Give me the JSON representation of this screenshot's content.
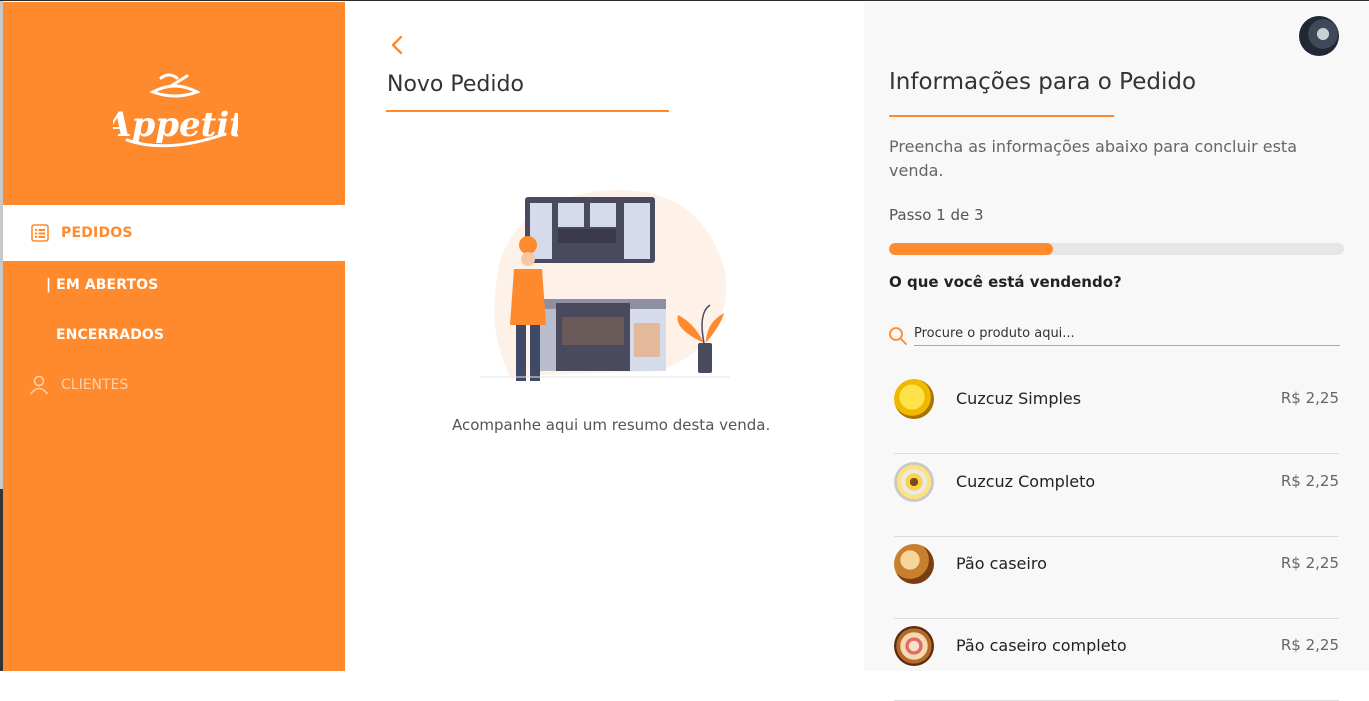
{
  "colors": {
    "accent": "#ff8a2e",
    "panel_bg": "#f8f8f8"
  },
  "sidebar": {
    "logo_text": "Appetit",
    "items": [
      {
        "label": "PEDIDOS",
        "icon": "list-icon",
        "active": true
      },
      {
        "label": "| EM ABERTOS"
      },
      {
        "label": "ENCERRADOS"
      },
      {
        "label": "CLIENTES",
        "icon": "user-icon"
      }
    ]
  },
  "main": {
    "title": "Novo Pedido",
    "caption": "Acompanhe aqui um resumo desta venda."
  },
  "panel": {
    "title": "Informações para o Pedido",
    "description": "Preencha as informações abaixo para concluir esta venda.",
    "step_text": "Passo 1 de 3",
    "progress_fraction": 0.36,
    "question": "O que você está vendendo?",
    "search_placeholder": "Procure o produto aqui...",
    "products": [
      {
        "name": "Cuzcuz Simples",
        "price": "R$ 2,25"
      },
      {
        "name": "Cuzcuz Completo",
        "price": "R$ 2,25"
      },
      {
        "name": "Pão caseiro",
        "price": "R$ 2,25"
      },
      {
        "name": "Pão caseiro completo",
        "price": "R$ 2,25"
      }
    ]
  }
}
